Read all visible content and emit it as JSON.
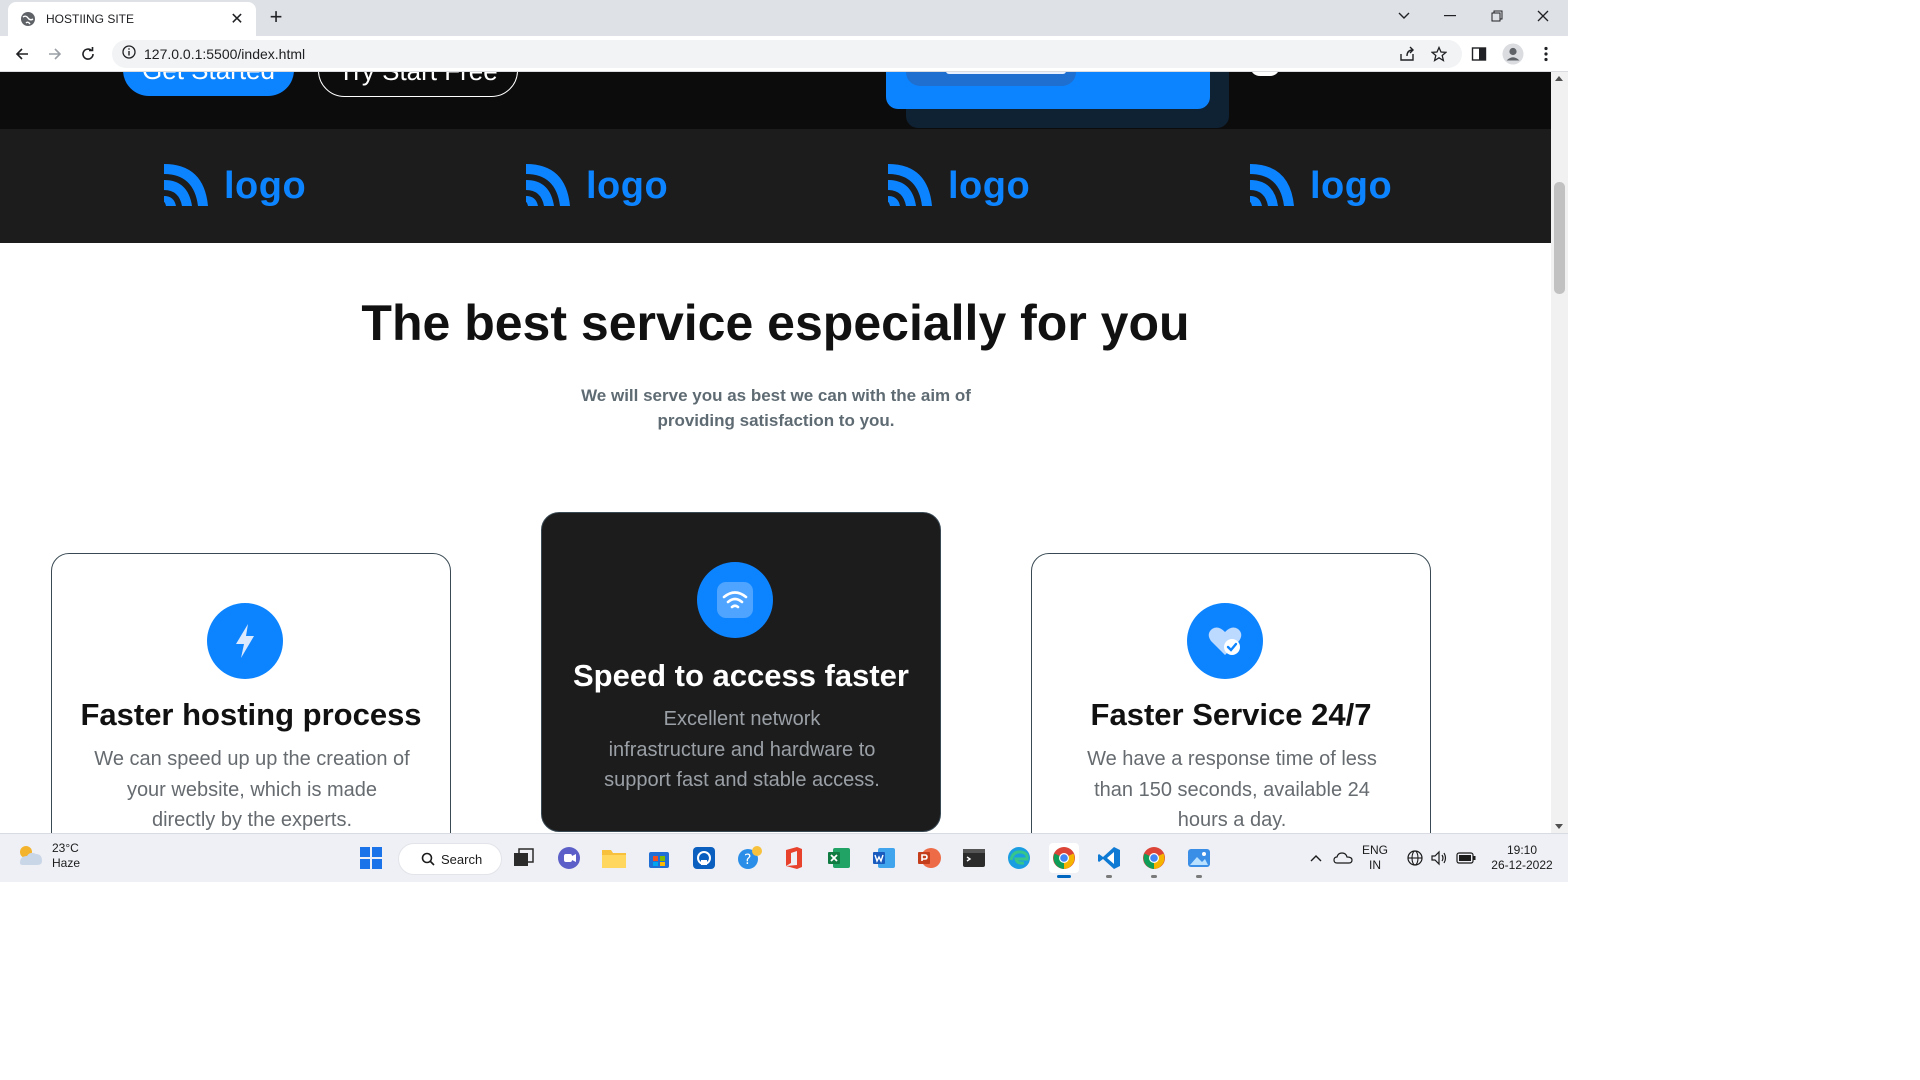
{
  "browser": {
    "tab_title": "HOSTIING SITE",
    "url": "127.0.0.1:5500/index.html"
  },
  "hero": {
    "primary_button": "Get Started",
    "secondary_button": "Try Start Free"
  },
  "logos": [
    "logo",
    "logo",
    "logo",
    "logo"
  ],
  "section": {
    "heading": "The best service especially for you",
    "subheading_line1": "We will serve you as best we can with the aim of",
    "subheading_line2": "providing satisfaction to you."
  },
  "cards": [
    {
      "title": "Faster hosting process",
      "desc_line1": "We can speed up up the creation of",
      "desc_line2": "your website, which is made",
      "desc_line3": "directly by the experts.",
      "icon": "lightning-icon"
    },
    {
      "title": "Speed to access faster",
      "desc_line1": "Excellent network",
      "desc_line2": "infrastructure and hardware to",
      "desc_line3": "support fast and stable access.",
      "icon": "wifi-icon"
    },
    {
      "title": "Faster Service 24/7",
      "desc_line1": "We have a response time of less",
      "desc_line2": "than 150 seconds, available 24",
      "desc_line3": "hours a day.",
      "icon": "heart-check-icon"
    }
  ],
  "taskbar": {
    "weather_temp": "23°C",
    "weather_desc": "Haze",
    "search_label": "Search",
    "lang_line1": "ENG",
    "lang_line2": "IN",
    "time": "19:10",
    "date": "26-12-2022"
  },
  "colors": {
    "accent": "#0d84ff",
    "hero_bg": "#0c0c0d",
    "logos_bg": "#1c1c1d",
    "dark_card_bg": "#1c1c1d"
  }
}
